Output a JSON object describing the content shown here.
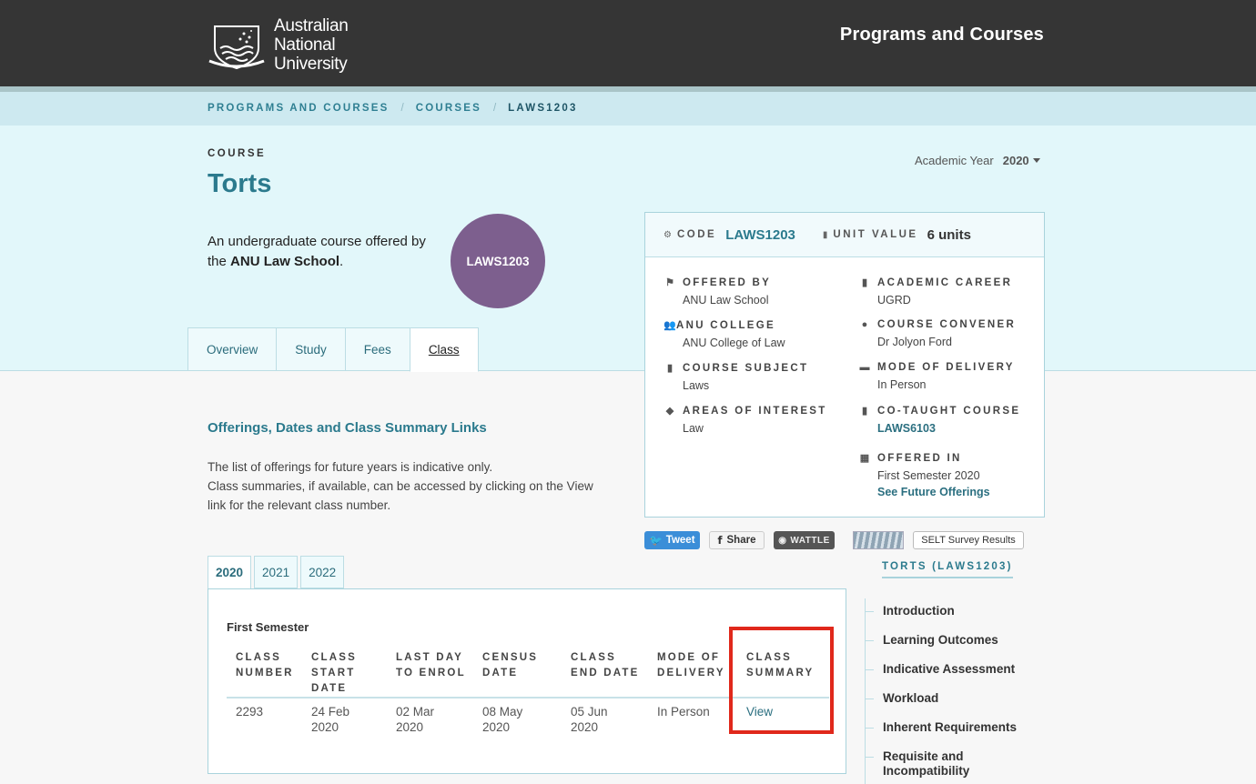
{
  "header": {
    "logo_lines": [
      "Australian",
      "National",
      "University"
    ],
    "site_title": "Programs and Courses"
  },
  "breadcrumb": {
    "items": [
      "PROGRAMS AND COURSES",
      "COURSES",
      "LAWS1203"
    ],
    "separator": "/"
  },
  "hero": {
    "label": "COURSE",
    "title": "Torts",
    "desc_prefix": "An undergraduate course offered by the ",
    "desc_school": "ANU Law School",
    "desc_suffix": ".",
    "circle_code": "LAWS1203",
    "academic_year_label": "Academic Year",
    "academic_year_value": "2020"
  },
  "tabs": [
    "Overview",
    "Study",
    "Fees",
    "Class"
  ],
  "infobox": {
    "code_label": "CODE",
    "code_value": "LAWS1203",
    "unit_label": "UNIT VALUE",
    "unit_value": "6 units",
    "offered_by_label": "OFFERED BY",
    "offered_by_value": "ANU Law School",
    "academic_career_label": "ACADEMIC CAREER",
    "academic_career_value": "UGRD",
    "college_label": "ANU COLLEGE",
    "college_value": "ANU College of Law",
    "convener_label": "COURSE CONVENER",
    "convener_value": "Dr Jolyon Ford",
    "subject_label": "COURSE SUBJECT",
    "subject_value": "Laws",
    "delivery_label": "MODE OF DELIVERY",
    "delivery_value": "In Person",
    "interest_label": "AREAS OF INTEREST",
    "interest_value": "Law",
    "cotaught_label": "CO-TAUGHT COURSE",
    "cotaught_value": "LAWS6103",
    "offered_in_label": "OFFERED IN",
    "offered_in_value": "First Semester 2020",
    "future_link": "See Future Offerings"
  },
  "share": {
    "tweet": "Tweet",
    "share": "Share",
    "wattle": "WATTLE",
    "selt": "SELT Survey Results"
  },
  "offerings": {
    "title": "Offerings, Dates and Class Summary Links",
    "text_line1": "The list of offerings for future years is indicative only.",
    "text_line2": "Class summaries, if available, can be accessed by clicking on the View link for the relevant class number.",
    "year_tabs": [
      "2020",
      "2021",
      "2022"
    ],
    "semester": "First Semester",
    "headers": [
      "CLASS NUMBER",
      "CLASS START DATE",
      "LAST DAY TO ENROL",
      "CENSUS DATE",
      "CLASS END DATE",
      "MODE OF DELIVERY",
      "CLASS SUMMARY"
    ],
    "row": [
      "2293",
      "24 Feb 2020",
      "02 Mar 2020",
      "08 May 2020",
      "05 Jun 2020",
      "In Person",
      "View"
    ]
  },
  "sidenav": {
    "title": "TORTS (LAWS1203)",
    "items": [
      "Introduction",
      "Learning Outcomes",
      "Indicative Assessment",
      "Workload",
      "Inherent Requirements",
      "Requisite and Incompatibility"
    ]
  },
  "colors": {
    "header_bg": "#353535",
    "accent_teal": "#2b7a8d",
    "hero_bg": "#e2f7fa",
    "circle": "#7d5f8e",
    "highlight": "#e0281b"
  }
}
